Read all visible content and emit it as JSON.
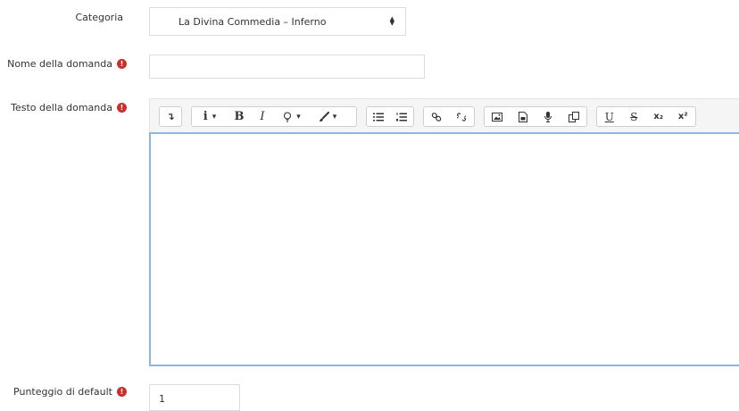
{
  "category": {
    "label": "Categoria",
    "selected": "La Divina Commedia – Inferno",
    "arrow_icon": "sort-icon"
  },
  "question_name": {
    "label": "Nome della domanda",
    "value": "",
    "required_icon": "exclamation-circle-icon"
  },
  "question_text": {
    "label": "Testo della domanda",
    "required_icon": "exclamation-circle-icon",
    "toolbar": {
      "toggle": "↴",
      "info": "i",
      "bold": "B",
      "italic": "I",
      "bulb": "♀",
      "brush": "🖌",
      "caret": "▾",
      "underline": "U",
      "strike": "S",
      "subscript": "x₂",
      "superscript": "x²"
    },
    "content": ""
  },
  "default_mark": {
    "label": "Punteggio di default",
    "value": "1",
    "required_icon": "exclamation-circle-icon"
  },
  "colors": {
    "required": "#c9302c",
    "editor_focus_border": "#8fb3e2"
  }
}
